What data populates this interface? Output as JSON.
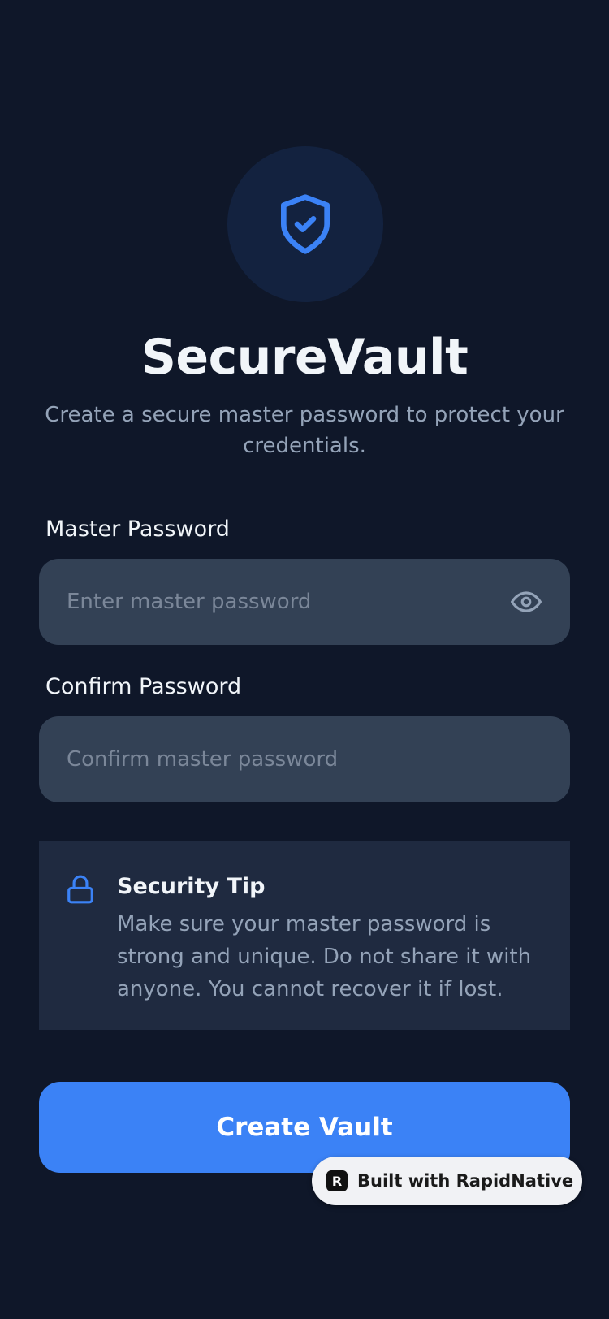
{
  "app": {
    "title": "SecureVault",
    "subtitle": "Create a secure master password to protect your credentials."
  },
  "form": {
    "master_label": "Master Password",
    "master_placeholder": "Enter master password",
    "master_value": "",
    "confirm_label": "Confirm Password",
    "confirm_placeholder": "Confirm master password",
    "confirm_value": ""
  },
  "tip": {
    "title": "Security Tip",
    "body": "Make sure your master password is strong and unique. Do not share it with anyone. You cannot recover it if lost."
  },
  "actions": {
    "create_label": "Create Vault"
  },
  "badge": {
    "logo_letter": "R",
    "label": "Built with RapidNative"
  },
  "icons": {
    "logo": "shield-check-icon",
    "visibility": "eye-icon",
    "tip": "lock-icon"
  },
  "colors": {
    "background": "#0F1729",
    "accent": "#3B82F6",
    "input_bg": "#334155",
    "card_bg": "#1F2A40",
    "muted_text": "#94A3B8"
  }
}
